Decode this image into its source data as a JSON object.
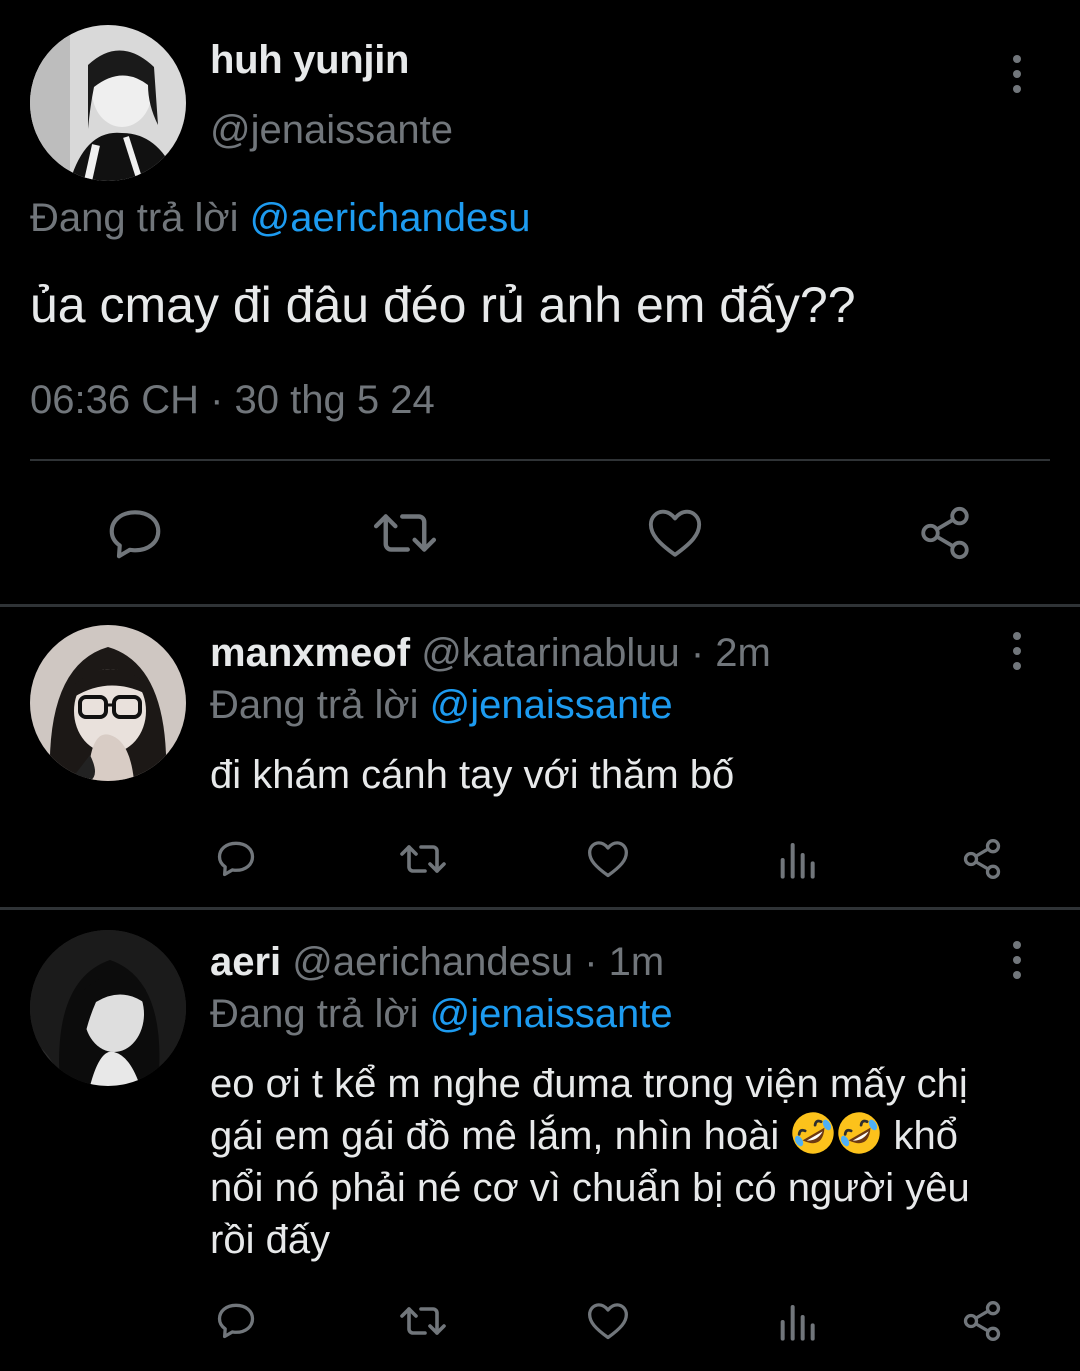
{
  "main_tweet": {
    "author_name": "huh yunjin",
    "author_handle": "@jenaissante",
    "replying_prefix": "Đang trả lời",
    "replying_to": "@aerichandesu",
    "text": "ủa cmay đi đâu đéo rủ anh em đấy??",
    "timestamp": "06:36 CH · 30 thg 5 24",
    "actions": [
      "reply-icon",
      "retweet-icon",
      "like-icon",
      "share-icon"
    ]
  },
  "replies": [
    {
      "author_name": "manxmeof",
      "meta": "@katarinabluu · 2m",
      "replying_prefix": "Đang trả lời",
      "replying_to": "@jenaissante",
      "text": "đi khám cánh tay với thăm bố",
      "actions": [
        "reply-icon",
        "retweet-icon",
        "like-icon",
        "views-icon",
        "share-icon"
      ]
    },
    {
      "author_name": "aeri",
      "meta": "@aerichandesu · 1m",
      "replying_prefix": "Đang trả lời",
      "replying_to": "@jenaissante",
      "text_line1": "eo ơi t kể m nghe đuma trong viện mấy chị",
      "text_line2_a": "gái em gái đồ mê lắm, nhìn hoài ",
      "text_line2_b": " khổ",
      "text_line3": "nổi nó phải né cơ vì chuẩn bị có người yêu",
      "text_line4": "rồi đấy",
      "emoji": "rolling-on-floor-laughing-emoji",
      "actions": [
        "reply-icon",
        "retweet-icon",
        "like-icon",
        "views-icon",
        "share-icon"
      ]
    }
  ],
  "colors": {
    "background": "#000000",
    "text_primary": "#e7e9ea",
    "text_secondary": "#71767b",
    "accent": "#1d9bf0",
    "divider": "#2f3336"
  }
}
